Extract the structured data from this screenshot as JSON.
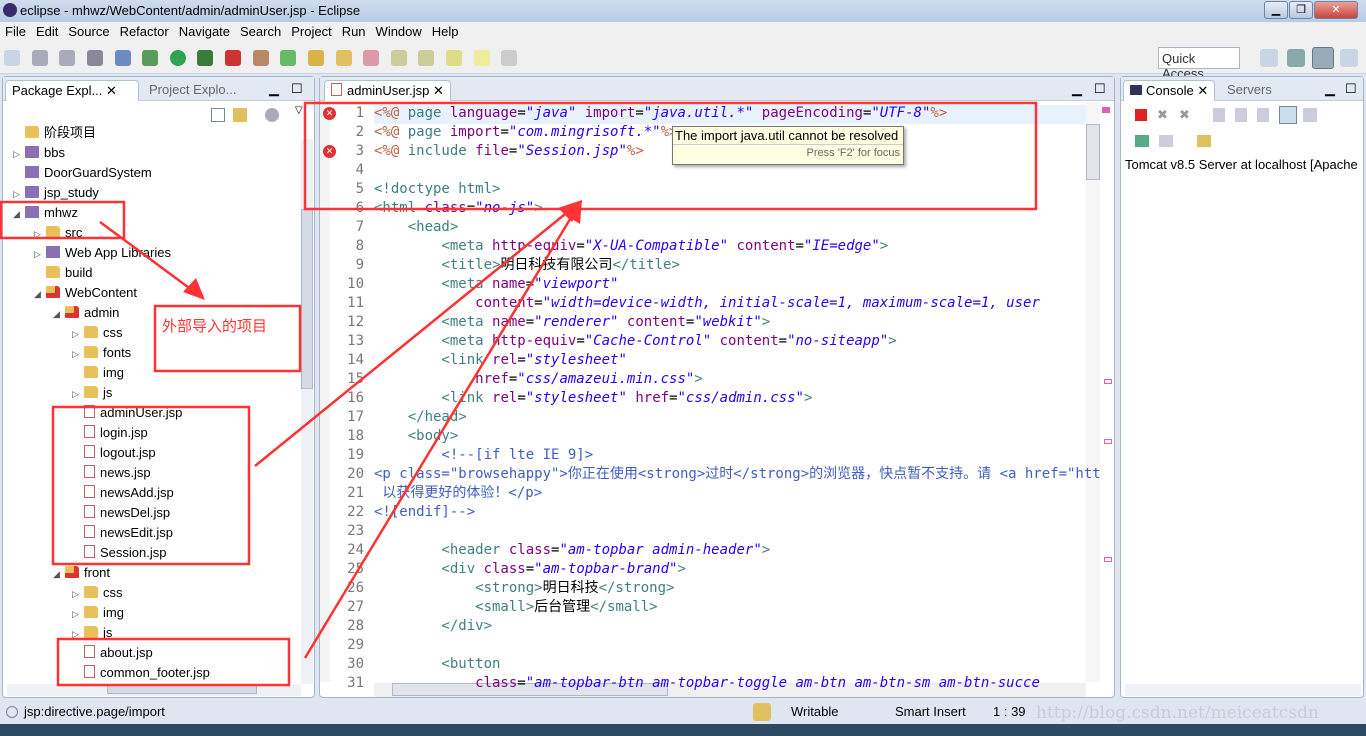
{
  "window": {
    "title": "eclipse - mhwz/WebContent/admin/adminUser.jsp - Eclipse"
  },
  "menu": [
    "File",
    "Edit",
    "Source",
    "Refactor",
    "Navigate",
    "Search",
    "Project",
    "Run",
    "Window",
    "Help"
  ],
  "quick_access": "Quick Access",
  "left_panel": {
    "tabs": [
      {
        "label": "Package Expl..."
      },
      {
        "label": "Project Explo..."
      }
    ],
    "tree": [
      {
        "label": "阶段项目",
        "depth": 0,
        "icon": "folder",
        "arrow": ""
      },
      {
        "label": "bbs",
        "depth": 0,
        "icon": "project",
        "arrow": "collapsed"
      },
      {
        "label": "DoorGuardSystem",
        "depth": 0,
        "icon": "project",
        "arrow": ""
      },
      {
        "label": "jsp_study",
        "depth": 0,
        "icon": "project",
        "arrow": "collapsed"
      },
      {
        "label": "mhwz",
        "depth": 0,
        "icon": "project",
        "arrow": "expanded"
      },
      {
        "label": "src",
        "depth": 1,
        "icon": "package",
        "arrow": "collapsed"
      },
      {
        "label": "Web App Libraries",
        "depth": 1,
        "icon": "library",
        "arrow": "collapsed"
      },
      {
        "label": "build",
        "depth": 1,
        "icon": "folder",
        "arrow": ""
      },
      {
        "label": "WebContent",
        "depth": 1,
        "icon": "folder-error",
        "arrow": "expanded"
      },
      {
        "label": "admin",
        "depth": 2,
        "icon": "folder-error",
        "arrow": "expanded"
      },
      {
        "label": "css",
        "depth": 3,
        "icon": "folder",
        "arrow": "collapsed"
      },
      {
        "label": "fonts",
        "depth": 3,
        "icon": "folder",
        "arrow": "collapsed"
      },
      {
        "label": "img",
        "depth": 3,
        "icon": "folder",
        "arrow": ""
      },
      {
        "label": "js",
        "depth": 3,
        "icon": "folder",
        "arrow": "collapsed"
      },
      {
        "label": "adminUser.jsp",
        "depth": 3,
        "icon": "jsp",
        "arrow": ""
      },
      {
        "label": "login.jsp",
        "depth": 3,
        "icon": "jsp",
        "arrow": ""
      },
      {
        "label": "logout.jsp",
        "depth": 3,
        "icon": "jsp",
        "arrow": ""
      },
      {
        "label": "news.jsp",
        "depth": 3,
        "icon": "jsp",
        "arrow": ""
      },
      {
        "label": "newsAdd.jsp",
        "depth": 3,
        "icon": "jsp",
        "arrow": ""
      },
      {
        "label": "newsDel.jsp",
        "depth": 3,
        "icon": "jsp",
        "arrow": ""
      },
      {
        "label": "newsEdit.jsp",
        "depth": 3,
        "icon": "jsp",
        "arrow": ""
      },
      {
        "label": "Session.jsp",
        "depth": 3,
        "icon": "jsp",
        "arrow": ""
      },
      {
        "label": "front",
        "depth": 2,
        "icon": "folder-error",
        "arrow": "expanded"
      },
      {
        "label": "css",
        "depth": 3,
        "icon": "folder",
        "arrow": "collapsed"
      },
      {
        "label": "img",
        "depth": 3,
        "icon": "folder",
        "arrow": "collapsed"
      },
      {
        "label": "js",
        "depth": 3,
        "icon": "folder",
        "arrow": "collapsed"
      },
      {
        "label": "about.jsp",
        "depth": 3,
        "icon": "jsp",
        "arrow": ""
      },
      {
        "label": "common_footer.jsp",
        "depth": 3,
        "icon": "jsp",
        "arrow": ""
      }
    ]
  },
  "editor": {
    "tab": "adminUser.jsp",
    "tooltip": {
      "message": "The import java.util cannot be resolved",
      "hint": "Press 'F2' for focus"
    },
    "error_lines": [
      1,
      3
    ],
    "lines": [
      [
        [
          "d",
          "<%@ "
        ],
        [
          "k",
          "page "
        ],
        [
          "a",
          "language"
        ],
        [
          "t",
          "="
        ],
        [
          "s",
          "\"java\""
        ],
        [
          "a",
          " import"
        ],
        [
          "t",
          "="
        ],
        [
          "s",
          "\"java.util.*\""
        ],
        [
          "a",
          " pageEncoding"
        ],
        [
          "t",
          "="
        ],
        [
          "s",
          "\"UTF-8\""
        ],
        [
          "d",
          "%>"
        ]
      ],
      [
        [
          "d",
          "<%@ "
        ],
        [
          "k",
          "page "
        ],
        [
          "a",
          "import"
        ],
        [
          "t",
          "="
        ],
        [
          "s",
          "\"com.mingrisoft.*\""
        ],
        [
          "d",
          "%>"
        ]
      ],
      [
        [
          "d",
          "<%@ "
        ],
        [
          "k",
          "include "
        ],
        [
          "a",
          "file"
        ],
        [
          "t",
          "="
        ],
        [
          "s",
          "\"Session.jsp\""
        ],
        [
          "d",
          "%>"
        ]
      ],
      [],
      [
        [
          "x",
          "<!doctype html>"
        ]
      ],
      [
        [
          "x",
          "<html "
        ],
        [
          "a",
          "class"
        ],
        [
          "t",
          "="
        ],
        [
          "s",
          "\"no-js\""
        ],
        [
          "x",
          ">"
        ]
      ],
      [
        [
          "x",
          "    <head>"
        ]
      ],
      [
        [
          "x",
          "        <meta "
        ],
        [
          "a",
          "http-equiv"
        ],
        [
          "t",
          "="
        ],
        [
          "s",
          "\"X-UA-Compatible\""
        ],
        [
          "a",
          " content"
        ],
        [
          "t",
          "="
        ],
        [
          "s",
          "\"IE=edge\""
        ],
        [
          "x",
          ">"
        ]
      ],
      [
        [
          "x",
          "        <title>"
        ],
        [
          "n",
          "明日科技有限公司"
        ],
        [
          "x",
          "</title>"
        ]
      ],
      [
        [
          "x",
          "        <meta "
        ],
        [
          "a",
          "name"
        ],
        [
          "t",
          "="
        ],
        [
          "s",
          "\"viewport\""
        ]
      ],
      [
        [
          "a",
          "            content"
        ],
        [
          "t",
          "="
        ],
        [
          "s",
          "\"width=device-width, initial-scale=1, maximum-scale=1, user"
        ]
      ],
      [
        [
          "x",
          "        <meta "
        ],
        [
          "a",
          "name"
        ],
        [
          "t",
          "="
        ],
        [
          "s",
          "\"renderer\""
        ],
        [
          "a",
          " content"
        ],
        [
          "t",
          "="
        ],
        [
          "s",
          "\"webkit\""
        ],
        [
          "x",
          ">"
        ]
      ],
      [
        [
          "x",
          "        <meta "
        ],
        [
          "a",
          "http-equiv"
        ],
        [
          "t",
          "="
        ],
        [
          "s",
          "\"Cache-Control\""
        ],
        [
          "a",
          " content"
        ],
        [
          "t",
          "="
        ],
        [
          "s",
          "\"no-siteapp\""
        ],
        [
          "x",
          ">"
        ]
      ],
      [
        [
          "x",
          "        <link "
        ],
        [
          "a",
          "rel"
        ],
        [
          "t",
          "="
        ],
        [
          "s",
          "\"stylesheet\""
        ]
      ],
      [
        [
          "a",
          "            href"
        ],
        [
          "t",
          "="
        ],
        [
          "s",
          "\"css/amazeui.min.css\""
        ],
        [
          "x",
          ">"
        ]
      ],
      [
        [
          "x",
          "        <link "
        ],
        [
          "a",
          "rel"
        ],
        [
          "t",
          "="
        ],
        [
          "s",
          "\"stylesheet\""
        ],
        [
          "a",
          " href"
        ],
        [
          "t",
          "="
        ],
        [
          "s",
          "\"css/admin.css\""
        ],
        [
          "x",
          ">"
        ]
      ],
      [
        [
          "x",
          "    </head>"
        ]
      ],
      [
        [
          "x",
          "    <body>"
        ]
      ],
      [
        [
          "c",
          "        <!--[if lte IE 9]>"
        ]
      ],
      [
        [
          "c",
          "<p class=\"browsehappy\">你正在使用<strong>过时</strong>的浏览器，快点暂不支持。请 <a href=\"htt"
        ]
      ],
      [
        [
          "c",
          " 以获得更好的体验！</p>"
        ]
      ],
      [
        [
          "c",
          "<![endif]-->"
        ]
      ],
      [],
      [
        [
          "x",
          "        <header "
        ],
        [
          "a",
          "class"
        ],
        [
          "t",
          "="
        ],
        [
          "s",
          "\"am-topbar admin-header\""
        ],
        [
          "x",
          ">"
        ]
      ],
      [
        [
          "x",
          "        <div "
        ],
        [
          "a",
          "class"
        ],
        [
          "t",
          "="
        ],
        [
          "s",
          "\"am-topbar-brand\""
        ],
        [
          "x",
          ">"
        ]
      ],
      [
        [
          "x",
          "            <strong>"
        ],
        [
          "n",
          "明日科技"
        ],
        [
          "x",
          "</strong>"
        ]
      ],
      [
        [
          "x",
          "            <small>"
        ],
        [
          "n",
          "后台管理"
        ],
        [
          "x",
          "</small>"
        ]
      ],
      [
        [
          "x",
          "        </div>"
        ]
      ],
      [],
      [
        [
          "x",
          "        <button"
        ]
      ],
      [
        [
          "a",
          "            class"
        ],
        [
          "t",
          "="
        ],
        [
          "s",
          "\"am-topbar-btn am-topbar-toggle am-btn am-btn-sm am-btn-succe"
        ]
      ]
    ]
  },
  "right_panel": {
    "tabs": [
      {
        "label": "Console"
      },
      {
        "label": "Servers"
      }
    ],
    "console_line": "Tomcat v8.5 Server at localhost [Apache"
  },
  "annotation": {
    "label": "外部导入的项目",
    "color": "#ff3333"
  },
  "status": {
    "left": "jsp:directive.page/import",
    "writable": "Writable",
    "insert": "Smart Insert",
    "position": "1 : 39",
    "watermark": "http://blog.csdn.net/meiceatcsdn"
  }
}
